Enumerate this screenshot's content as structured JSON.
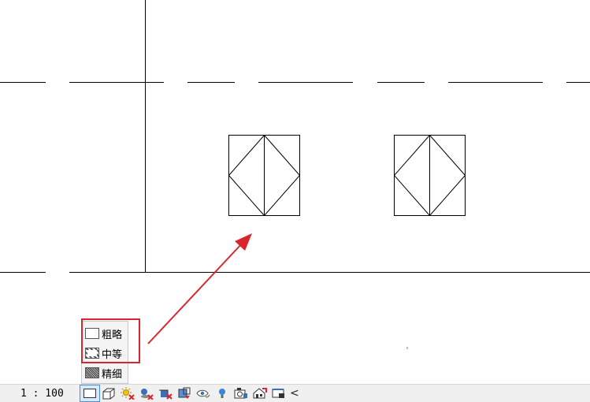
{
  "view_scale": "1 : 100",
  "detail_menu": {
    "items": [
      {
        "label": "粗略",
        "icon": "detail-coarse-icon"
      },
      {
        "label": "中等",
        "icon": "detail-medium-icon"
      },
      {
        "label": "精细",
        "icon": "detail-fine-icon"
      }
    ]
  },
  "toolbar": {
    "icons": [
      "detail-level-icon",
      "visual-style-icon",
      "sun-path-icon",
      "shadows-icon",
      "crop-view-icon",
      "show-crop-region-icon",
      "temporary-hide-icon",
      "reveal-hidden-icon",
      "temporary-view-properties-icon",
      "render-icon",
      "lock-3d-view-icon"
    ],
    "collapse_glyph": "<"
  },
  "colors": {
    "annotation": "#d9262e",
    "drawing": "#000000",
    "statusbar_bg": "#f0f0f0"
  }
}
